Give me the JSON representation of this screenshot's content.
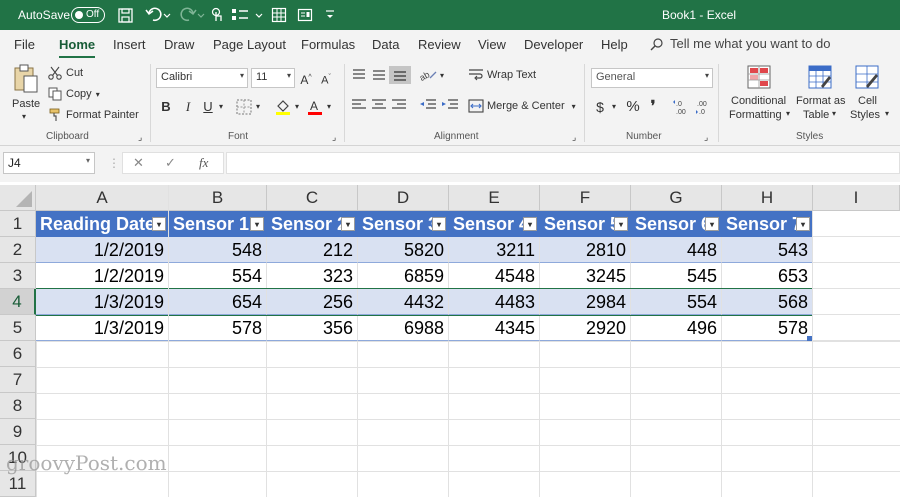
{
  "titlebar": {
    "autosave_label": "AutoSave",
    "autosave_state": "Off",
    "title": "Book1  -  Excel"
  },
  "tabs": [
    "File",
    "Home",
    "Insert",
    "Draw",
    "Page Layout",
    "Formulas",
    "Data",
    "Review",
    "View",
    "Developer",
    "Help"
  ],
  "active_tab": "Home",
  "tell_me": "Tell me what you want to do",
  "ribbon": {
    "clipboard": {
      "paste": "Paste",
      "cut": "Cut",
      "copy": "Copy",
      "format_painter": "Format Painter",
      "label": "Clipboard"
    },
    "font": {
      "name": "Calibri",
      "size": "11",
      "label": "Font"
    },
    "alignment": {
      "wrap_text": "Wrap Text",
      "merge_center": "Merge & Center",
      "label": "Alignment"
    },
    "number": {
      "format": "General",
      "label": "Number"
    },
    "styles": {
      "conditional_1": "Conditional",
      "conditional_2": "Formatting",
      "format_as_1": "Format as",
      "format_as_2": "Table",
      "cell_1": "Cell",
      "cell_2": "Styles",
      "label": "Styles"
    }
  },
  "formula_bar": {
    "name_box": "J4",
    "fx": "fx",
    "value": ""
  },
  "sheet": {
    "columns": [
      "A",
      "B",
      "C",
      "D",
      "E",
      "F",
      "G",
      "H",
      "I"
    ],
    "rows": [
      "1",
      "2",
      "3",
      "4",
      "5",
      "6",
      "7",
      "8",
      "9",
      "10",
      "11"
    ],
    "table_headers": [
      "Reading Date",
      "Sensor 1",
      "Sensor 2",
      "Sensor 3",
      "Sensor 4",
      "Sensor 5",
      "Sensor 6",
      "Sensor 7"
    ],
    "table_rows": [
      [
        "1/2/2019",
        "548",
        "212",
        "5820",
        "3211",
        "2810",
        "448",
        "543"
      ],
      [
        "1/2/2019",
        "554",
        "323",
        "6859",
        "4548",
        "3245",
        "545",
        "653"
      ],
      [
        "1/3/2019",
        "654",
        "256",
        "4432",
        "4483",
        "2984",
        "554",
        "568"
      ],
      [
        "1/3/2019",
        "578",
        "356",
        "6988",
        "4345",
        "2920",
        "496",
        "578"
      ]
    ],
    "selected_row": "4"
  },
  "watermark": "groovyPost.com",
  "colors": {
    "excel_green": "#217346",
    "table_header": "#4472c4",
    "table_band": "#d9e1f2"
  }
}
